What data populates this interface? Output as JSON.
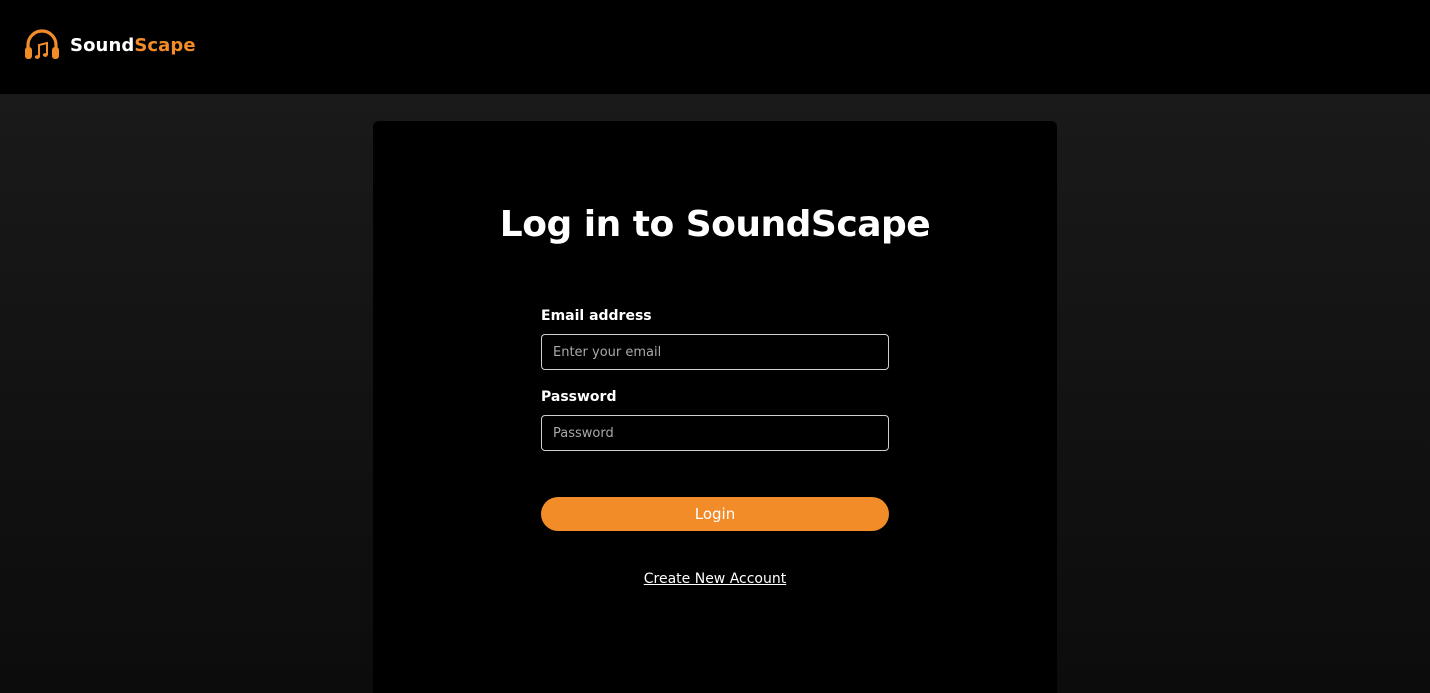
{
  "header": {
    "brand_part1": "Sound",
    "brand_part2": "Scape",
    "logo_icon": "headphones-music-icon",
    "accent_color": "#f28c28"
  },
  "login": {
    "title": "Log in to SoundScape",
    "email_label": "Email address",
    "email_placeholder": "Enter your email",
    "email_value": "",
    "password_label": "Password",
    "password_placeholder": "Password",
    "password_value": "",
    "login_button": "Login",
    "create_account_link": "Create New Account"
  }
}
